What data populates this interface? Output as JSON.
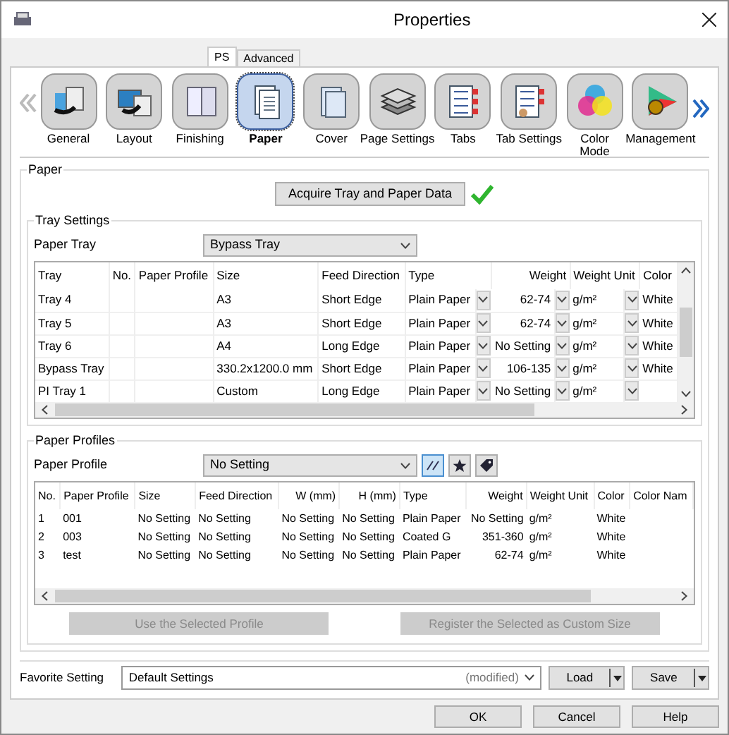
{
  "window": {
    "title": "Properties"
  },
  "tabs": [
    {
      "label": "PS",
      "selected": true
    },
    {
      "label": "Advanced",
      "selected": false
    }
  ],
  "categories": [
    {
      "label": "General",
      "selected": false
    },
    {
      "label": "Layout",
      "selected": false
    },
    {
      "label": "Finishing",
      "selected": false
    },
    {
      "label": "Paper",
      "selected": true
    },
    {
      "label": "Cover",
      "selected": false
    },
    {
      "label": "Page Settings",
      "selected": false
    },
    {
      "label": "Tabs",
      "selected": false
    },
    {
      "label": "Tab Settings",
      "selected": false
    },
    {
      "label": "Color Mode",
      "selected": false
    },
    {
      "label": "Management",
      "selected": false
    }
  ],
  "paper_group": {
    "title": "Paper",
    "acquire_button": "Acquire Tray and Paper Data",
    "acquired": true
  },
  "tray_settings": {
    "title": "Tray Settings",
    "paper_tray_label": "Paper Tray",
    "paper_tray_value": "Bypass Tray",
    "columns": [
      "Tray",
      "No.",
      "Paper Profile",
      "Size",
      "Feed Direction",
      "Type",
      "Weight",
      "Weight Unit",
      "Color"
    ],
    "rows": [
      [
        "Tray 4",
        "",
        "",
        "A3",
        "Short Edge",
        "Plain Paper",
        "62-74",
        "g/m²",
        "White"
      ],
      [
        "Tray 5",
        "",
        "",
        "A3",
        "Short Edge",
        "Plain Paper",
        "62-74",
        "g/m²",
        "White"
      ],
      [
        "Tray 6",
        "",
        "",
        "A4",
        "Long Edge",
        "Plain Paper",
        "No Setting",
        "g/m²",
        "White"
      ],
      [
        "Bypass Tray",
        "",
        "",
        "330.2x1200.0 mm",
        "Short Edge",
        "Plain Paper",
        "106-135",
        "g/m²",
        "White"
      ],
      [
        "PI Tray 1",
        "",
        "",
        "Custom",
        "Long Edge",
        "Plain Paper",
        "No Setting",
        "g/m²",
        ""
      ]
    ]
  },
  "paper_profiles": {
    "title": "Paper Profiles",
    "profile_label": "Paper Profile",
    "profile_value": "No Setting",
    "tools": [
      {
        "selected": true
      },
      {
        "selected": false
      },
      {
        "selected": false
      }
    ],
    "columns": [
      "No.",
      "Paper Profile",
      "Size",
      "Feed Direction",
      "W (mm)",
      "H (mm)",
      "Type",
      "Weight",
      "Weight Unit",
      "Color",
      "Color Nam"
    ],
    "rows": [
      [
        "1",
        "001",
        "No Setting",
        "No Setting",
        "No Setting",
        "No Setting",
        "Plain Paper",
        "No Setting",
        "g/m²",
        "White",
        ""
      ],
      [
        "2",
        "003",
        "No Setting",
        "No Setting",
        "No Setting",
        "No Setting",
        "Coated G",
        "351-360",
        "g/m²",
        "White",
        ""
      ],
      [
        "3",
        "test",
        "No Setting",
        "No Setting",
        "No Setting",
        "No Setting",
        "Plain Paper",
        "62-74",
        "g/m²",
        "White",
        ""
      ]
    ],
    "buttons": [
      {
        "label": "Use the Selected Profile",
        "disabled": true
      },
      {
        "label": "Register the Selected as Custom Size",
        "disabled": true
      }
    ]
  },
  "favorite": {
    "label": "Favorite Setting",
    "value": "Default Settings",
    "note": "(modified)",
    "buttons": [
      "Load",
      "Save"
    ]
  },
  "footer_buttons": [
    "OK",
    "Cancel",
    "Help"
  ]
}
